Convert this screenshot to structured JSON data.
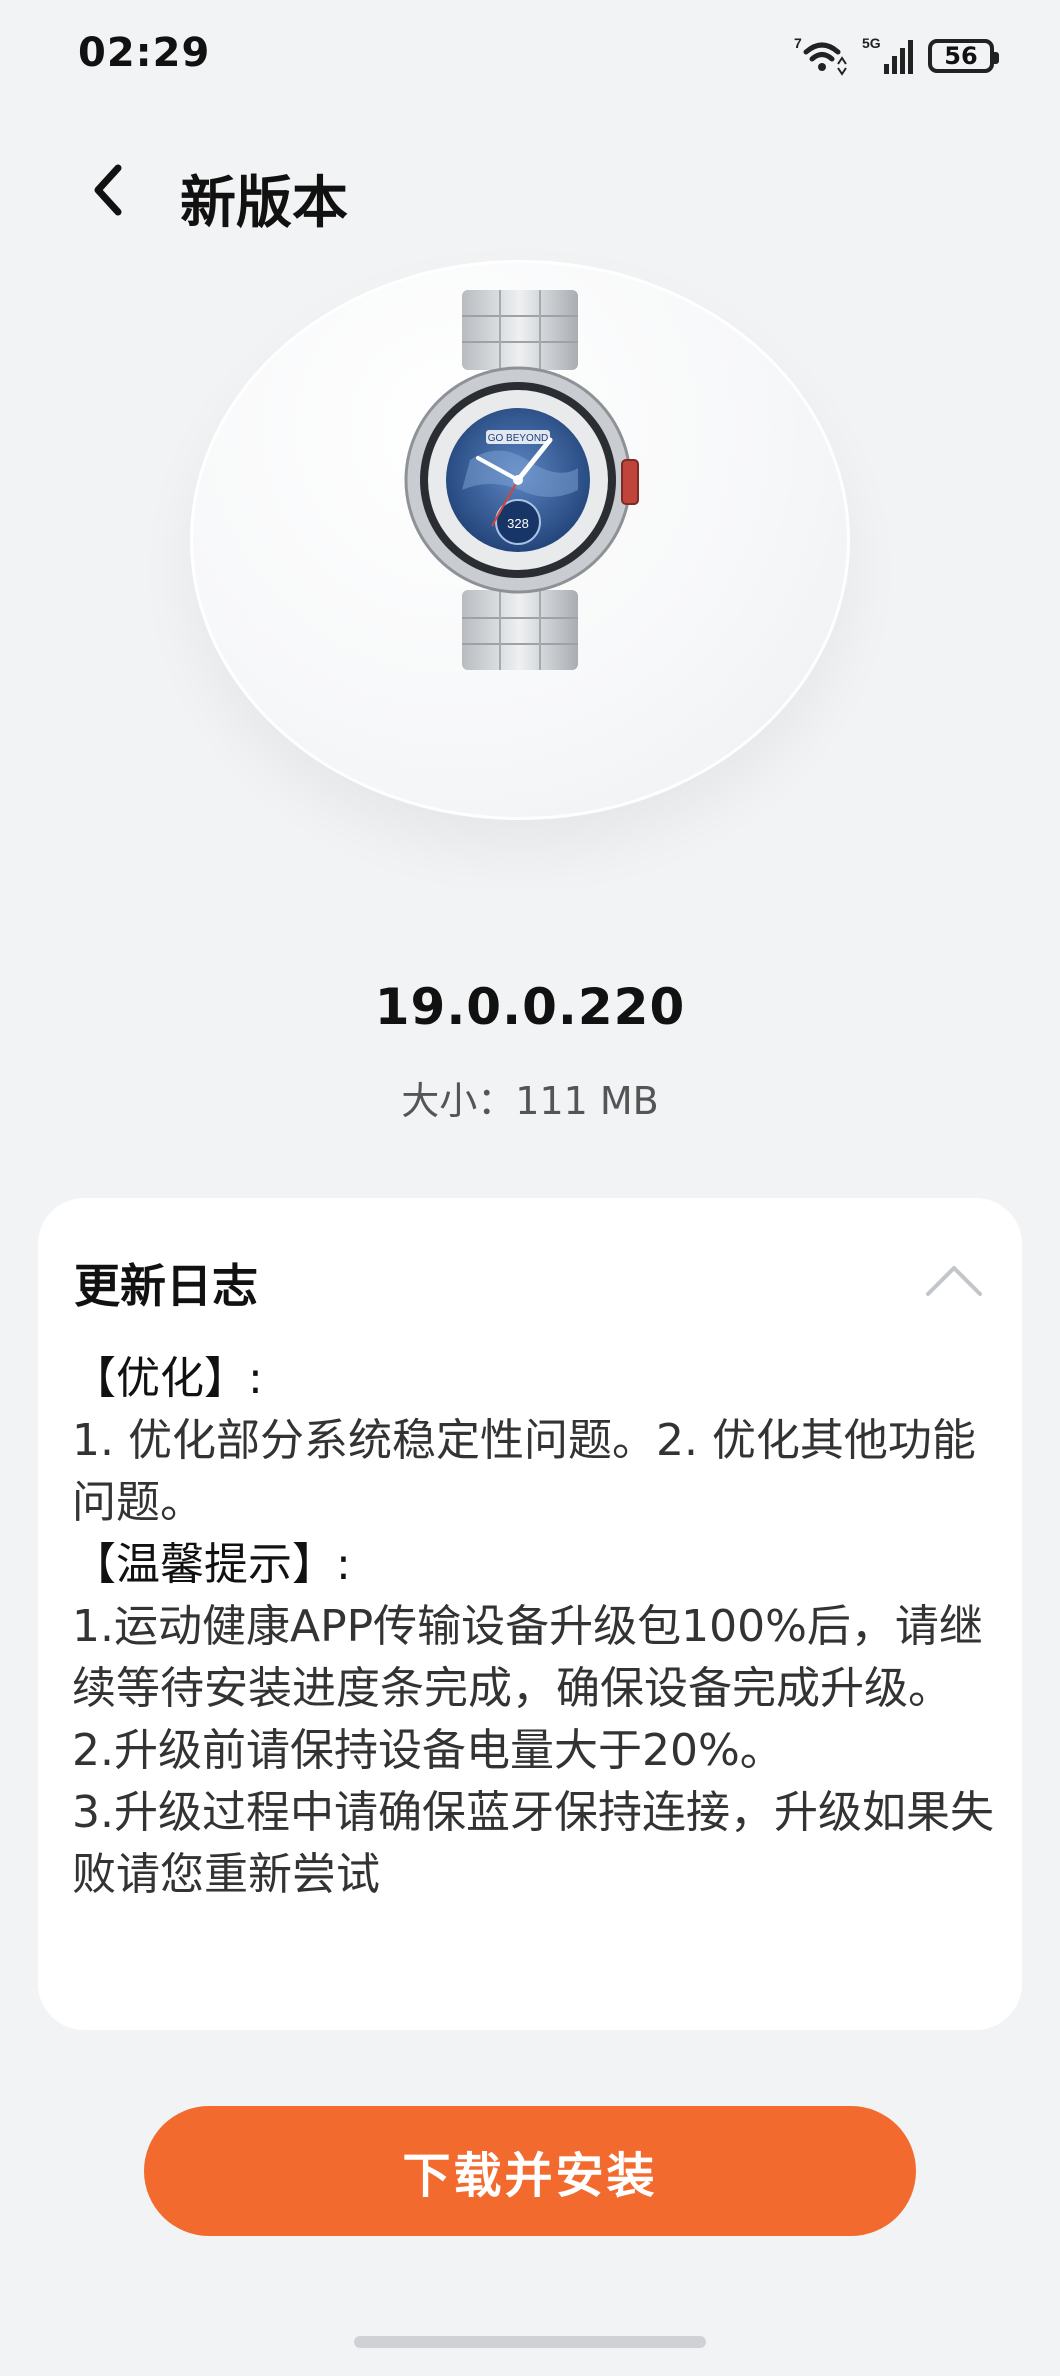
{
  "status_bar": {
    "time": "02:29",
    "battery": "56",
    "wifi_label": "7",
    "network_label": "5G",
    "icons": [
      "wifi-icon",
      "signal-icon",
      "battery-icon"
    ]
  },
  "header": {
    "back_icon": "chevron-left-icon",
    "title": "新版本"
  },
  "device": {
    "image": "smartwatch-image",
    "watch_text": "GO BEYOND",
    "watch_number": "328"
  },
  "update": {
    "version": "19.0.0.220",
    "size": "大小：111 MB"
  },
  "changelog": {
    "title": "更新日志",
    "collapse_icon": "chevron-up-icon",
    "lines": [
      "【优化】:",
      "1. 优化部分系统稳定性问题。2. 优化其他功能问题。",
      "【温馨提示】:",
      "1.运动健康APP传输设备升级包100%后，请继续等待安装进度条完成，确保设备完成升级。",
      "2.升级前请保持设备电量大于20%。",
      "3.升级过程中请确保蓝牙保持连接，升级如果失败请您重新尝试"
    ]
  },
  "actions": {
    "install_label": "下载并安装"
  },
  "colors": {
    "accent": "#f26a2e",
    "background": "#f1f3f5"
  }
}
